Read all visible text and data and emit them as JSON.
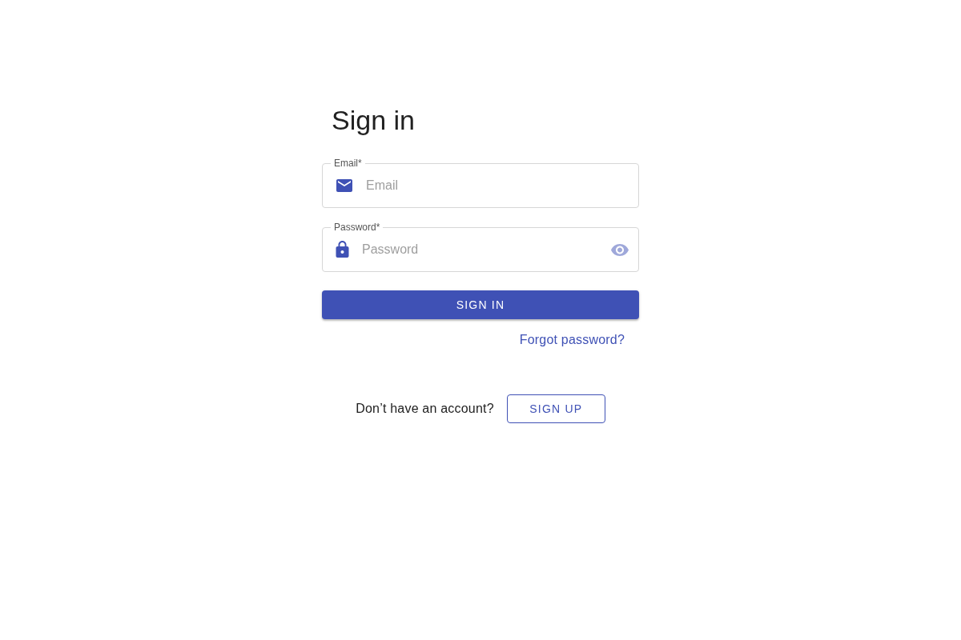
{
  "title": "Sign in",
  "fields": [
    {
      "kind": "email",
      "label": "Email*",
      "placeholder": "Email",
      "reveal_toggle": false
    },
    {
      "kind": "password",
      "label": "Password*",
      "placeholder": "Password",
      "reveal_toggle": true
    }
  ],
  "submit": "SIGN IN",
  "forgot_link": "Forgot password?",
  "signup": {
    "prompt": "Don’t have an account?",
    "button": "SIGN UP"
  }
}
